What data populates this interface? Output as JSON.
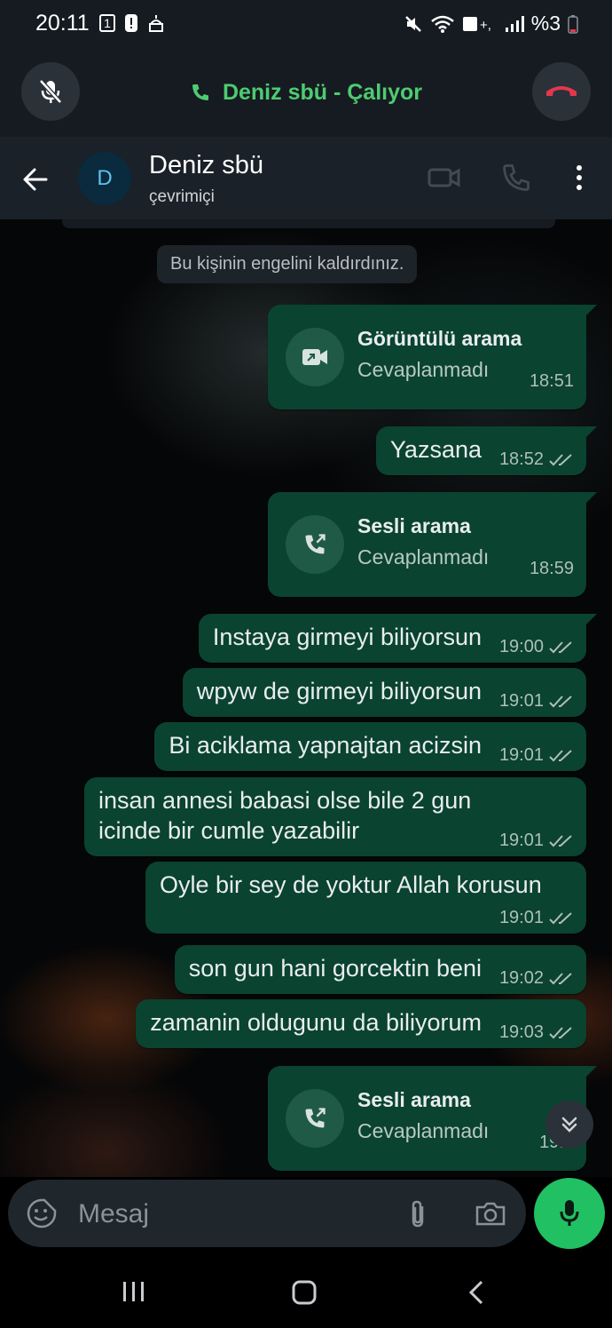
{
  "status_bar": {
    "time": "20:11",
    "notification_badge": "1",
    "battery": "%3",
    "icons": [
      "sim-1-icon",
      "alert-icon",
      "mosque-icon",
      "mute-icon",
      "wifi-icon",
      "volte-icon",
      "signal-icon",
      "battery-icon"
    ]
  },
  "call_bar": {
    "status_text": "Deniz sbü - Çalıyor",
    "accent": "#4ecb71",
    "end_color": "#e4374d"
  },
  "header": {
    "avatar_initial": "D",
    "contact_name": "Deniz sbü",
    "presence": "çevrimiçi"
  },
  "chat": {
    "system_message": "Bu kişinin engelini kaldırdınız.",
    "messages": [
      {
        "type": "call",
        "title": "Görüntülü arama",
        "subtitle": "Cevaplanmadı",
        "time": "18:51",
        "icon": "video-camera-icon"
      },
      {
        "type": "text",
        "text": "Yazsana",
        "time": "18:52"
      },
      {
        "type": "call",
        "title": "Sesli arama",
        "subtitle": "Cevaplanmadı",
        "time": "18:59",
        "icon": "outgoing-call-icon"
      },
      {
        "type": "text",
        "text": "Instaya girmeyi biliyorsun",
        "time": "19:00"
      },
      {
        "type": "text",
        "text": "wpyw de girmeyi biliyorsun",
        "time": "19:01"
      },
      {
        "type": "text",
        "text": "Bi aciklama yapnajtan acizsin",
        "time": "19:01"
      },
      {
        "type": "text",
        "text": "insan annesi babasi olse bile 2 gun\nicinde bir cumle yazabilir",
        "time": "19:01"
      },
      {
        "type": "text",
        "text": "Oyle bir sey de yoktur Allah korusun",
        "time": "19:01"
      },
      {
        "type": "text",
        "text": "son gun hani gorcektin beni",
        "time": "19:02"
      },
      {
        "type": "text",
        "text": "zamanin oldugunu da biliyorum",
        "time": "19:03"
      },
      {
        "type": "call",
        "title": "Sesli arama",
        "subtitle": "Cevaplanmadı",
        "time": "19:3",
        "icon": "outgoing-call-icon"
      }
    ],
    "bubble_color": "#0a4330"
  },
  "composer": {
    "placeholder": "Mesaj",
    "send_color": "#21c063"
  }
}
